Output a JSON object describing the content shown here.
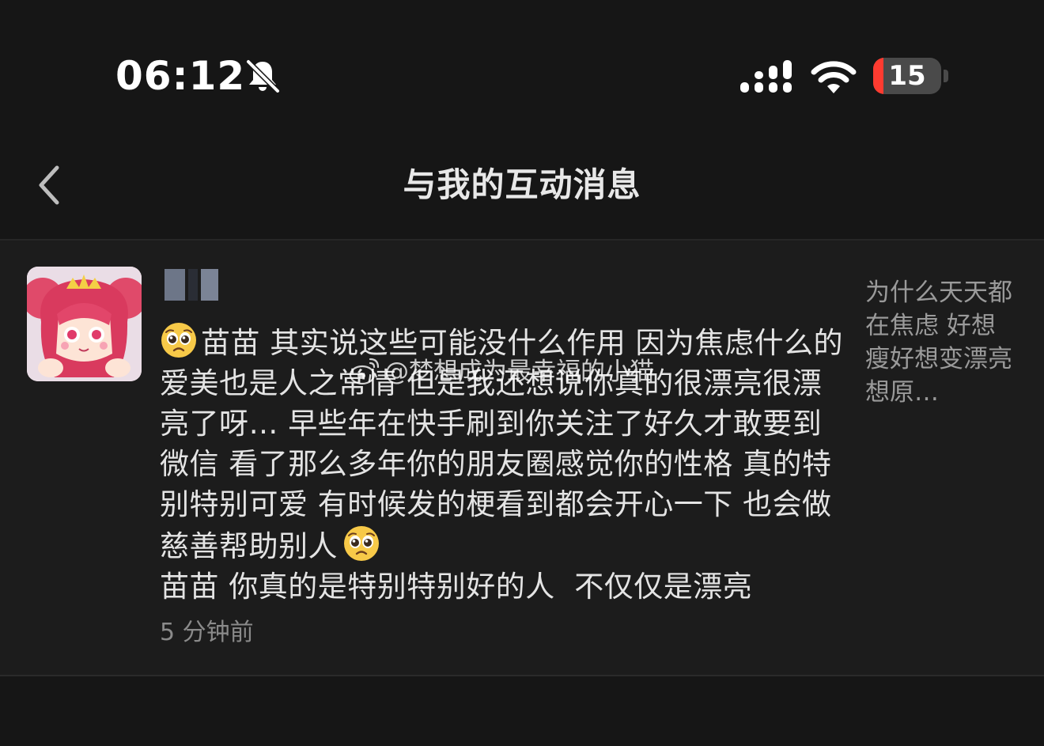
{
  "status_bar": {
    "time": "06:12",
    "battery_level": "15",
    "battery_fraction": 0.15,
    "icons": [
      "bell-off-icon",
      "cell-signal-icon",
      "wifi-icon",
      "battery-icon"
    ]
  },
  "nav": {
    "back_icon": "chevron-left-icon",
    "title": "与我的互动消息"
  },
  "message": {
    "text": "苗苗 其实说这些可能没什么作用 因为焦虑什么的 爱美也是人之常情 但是我还想说你真的很漂亮很漂亮了呀… 早些年在快手刷到你关注了好久才敢要到微信 看了那么多年你的朋友圈感觉你的性格 真的特别特别可爱 有时候发的梗看到都会开心一下 也会做慈善帮助别人",
    "text_line2": "苗苗 你真的是特别特别好的人  不仅仅是漂亮",
    "emoji_icon": "pleading-face-emoji-icon",
    "timestamp": "5 分钟前",
    "quoted_preview": "为什么天天都在焦虑 好想瘦好想变漂亮 想原…"
  },
  "watermark": {
    "text": "@梦想成为最幸福的小猫",
    "logo_icon": "weibo-logo-icon"
  }
}
